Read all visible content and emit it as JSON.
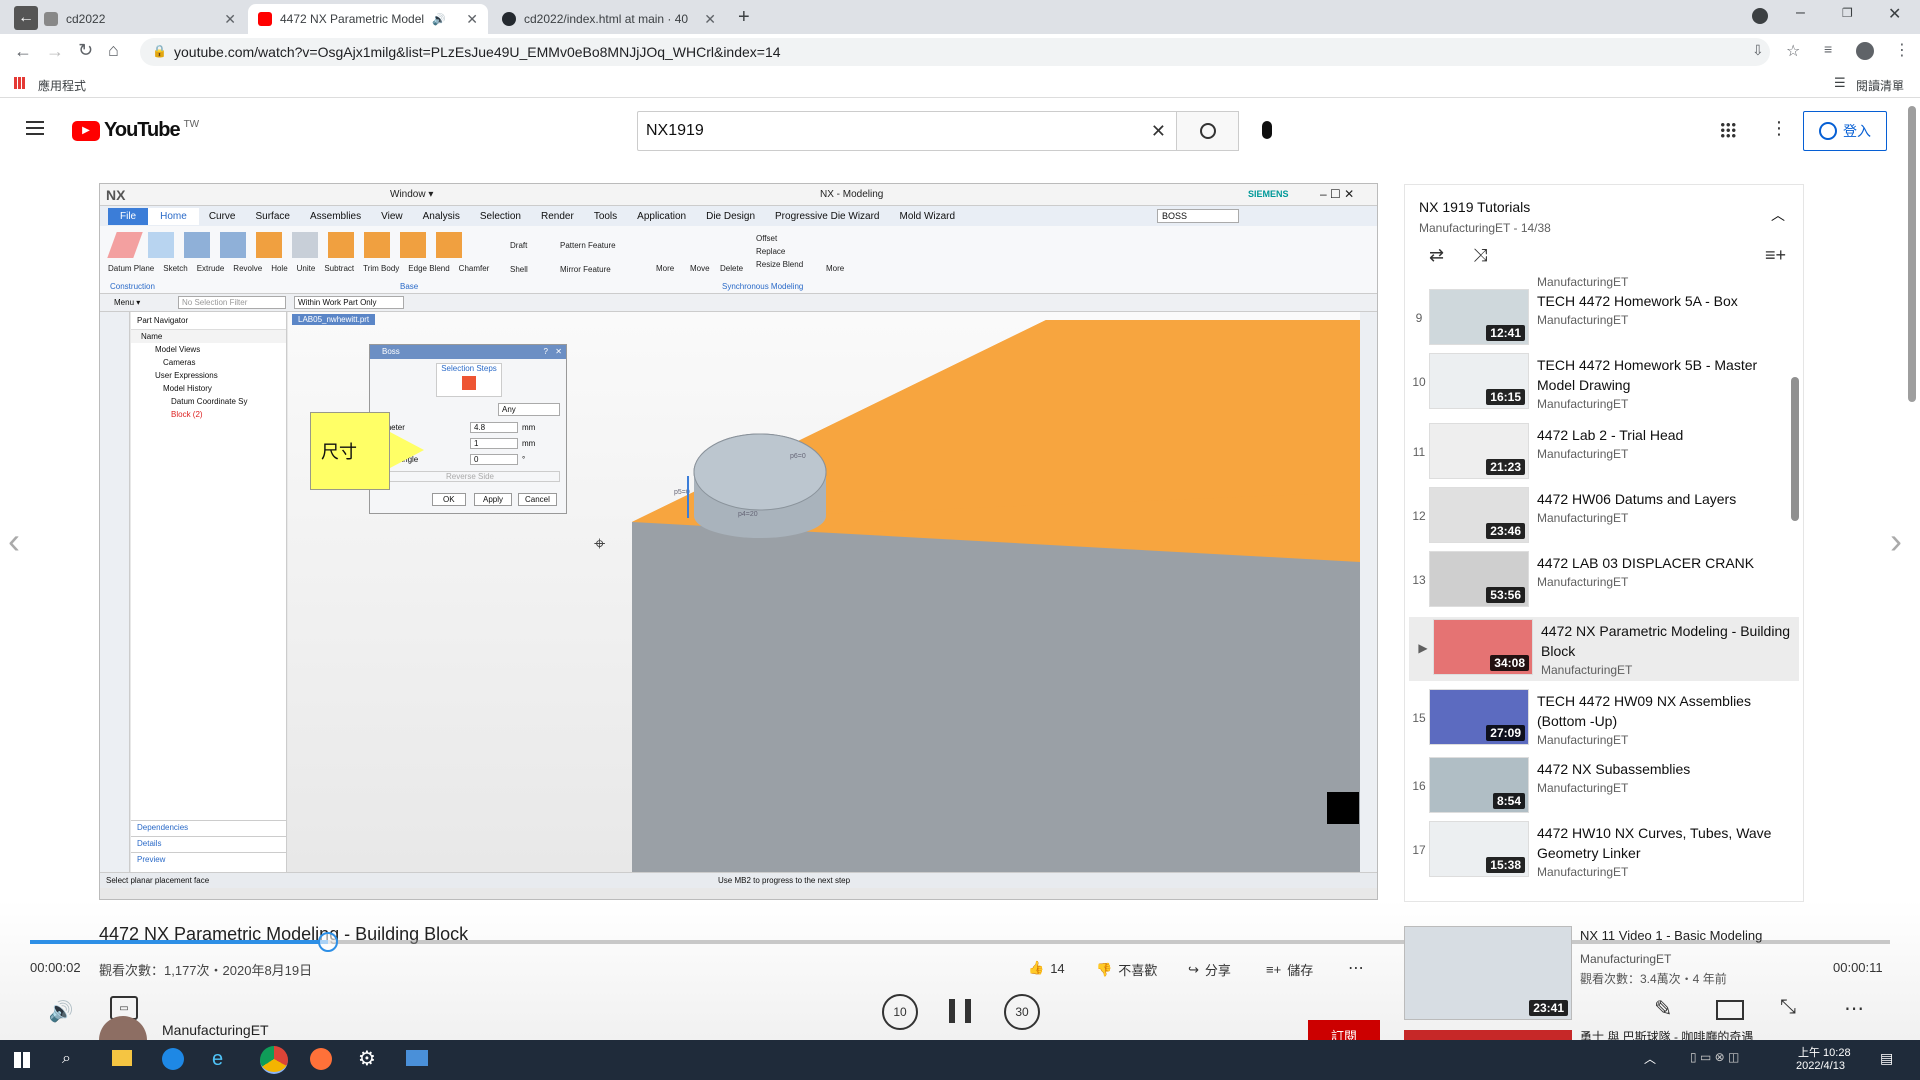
{
  "browser": {
    "tabs": [
      {
        "title": "cd2022",
        "fav": "#888"
      },
      {
        "title": "4472 NX Parametric Model",
        "fav": "#ff0000"
      },
      {
        "title": "cd2022/index.html at main · 40",
        "fav": "#24292f"
      }
    ],
    "url": "youtube.com/watch?v=OsgAjx1milg&list=PLzEsJue49U_EMMv0eBo8MNJjJOq_WHCrl&index=14",
    "bookmarks_apps": "應用程式",
    "reading_list": "閱讀清單"
  },
  "youtube": {
    "logo_text": "YouTube",
    "region": "TW",
    "search_value": "NX1919",
    "signin_label": "登入"
  },
  "nx": {
    "title": "NX - Modeling",
    "brand": "SIEMENS",
    "window_menu": "Window ▾",
    "file_tab": "File",
    "ribbon_tabs": [
      "Home",
      "Curve",
      "Surface",
      "Assemblies",
      "View",
      "Analysis",
      "Selection",
      "Render",
      "Tools",
      "Application",
      "Die Design",
      "Progressive Die Wizard",
      "Mold Wizard"
    ],
    "search_value": "BOSS",
    "tools": [
      "Datum Plane",
      "Sketch",
      "Extrude",
      "Revolve",
      "Hole",
      "Unite",
      "Subtract",
      "Trim Body",
      "Edge Blend",
      "Chamfer",
      "More",
      "Move",
      "Delete",
      "More"
    ],
    "tools_small": [
      "Draft",
      "Shell",
      "Pattern Feature",
      "Mirror Feature",
      "Offset",
      "Replace",
      "Resize Blend"
    ],
    "groups": [
      "Construction",
      "Base",
      "Synchronous Modeling"
    ],
    "menu_label": "Menu ▾",
    "filter_placeholder": "No Selection Filter",
    "scope": "Within Work Part Only",
    "navigator_title": "Part Navigator",
    "nav_col": "Name",
    "nav_items": [
      "Model Views",
      "Cameras",
      "User Expressions",
      "Model History",
      "Datum Coordinate Sy",
      "Block (2)"
    ],
    "nav_panels": [
      "Dependencies",
      "Details",
      "Preview"
    ],
    "file_tab_name": "LAB05_nwhewitt.prt",
    "dialog": {
      "title": "Boss",
      "steps_label": "Selection Steps",
      "filter": "Any",
      "rows": [
        {
          "label": "ameter",
          "value": "4.8",
          "unit": "mm"
        },
        {
          "label": "ight",
          "value": "1",
          "unit": "mm"
        },
        {
          "label": "aper Angle",
          "value": "0",
          "unit": "°"
        }
      ],
      "reverse": "Reverse Side",
      "ok": "OK",
      "apply": "Apply",
      "cancel": "Cancel"
    },
    "callout": "尺寸",
    "status_left": "Select planar placement face",
    "status_center": "Use MB2 to progress to the next step",
    "label_p6": "p6=0",
    "label_p4": "p4=20",
    "label_p5": "p5=0"
  },
  "playlist": {
    "title": "NX 1919 Tutorials",
    "meta": "ManufacturingET - 14/38",
    "top_channel": "ManufacturingET",
    "items": [
      {
        "num": "9",
        "title": "TECH 4472 Homework 5A - Box",
        "channel": "ManufacturingET",
        "duration": "12:41",
        "color": "#cfd8dc"
      },
      {
        "num": "10",
        "title": "TECH 4472 Homework 5B - Master Model Drawing",
        "channel": "ManufacturingET",
        "duration": "16:15",
        "color": "#eceff1"
      },
      {
        "num": "11",
        "title": "4472 Lab 2 - Trial Head",
        "channel": "ManufacturingET",
        "duration": "21:23",
        "color": "#eeeeee"
      },
      {
        "num": "12",
        "title": "4472 HW06 Datums and Layers",
        "channel": "ManufacturingET",
        "duration": "23:46",
        "color": "#e0e0e0"
      },
      {
        "num": "13",
        "title": "4472 LAB 03 DISPLACER CRANK",
        "channel": "ManufacturingET",
        "duration": "53:56",
        "color": "#cfcfcf"
      },
      {
        "num": "▶",
        "title": "4472 NX Parametric Modeling - Building Block",
        "channel": "ManufacturingET",
        "duration": "34:08",
        "color": "#e57373"
      },
      {
        "num": "15",
        "title": "TECH 4472 HW09 NX Assemblies (Bottom -Up)",
        "channel": "ManufacturingET",
        "duration": "27:09",
        "color": "#5c6bc0"
      },
      {
        "num": "16",
        "title": "4472 NX Subassemblies",
        "channel": "ManufacturingET",
        "duration": "8:54",
        "color": "#b0bec5"
      },
      {
        "num": "17",
        "title": "4472 HW10 NX Curves, Tubes, Wave Geometry Linker",
        "channel": "ManufacturingET",
        "duration": "15:38",
        "color": "#eceff1"
      }
    ]
  },
  "video_info": {
    "title": "4472 NX Parametric Modeling - Building Block",
    "views": "觀看次數：1,177次・2020年8月19日",
    "likes": "14",
    "dislike": "不喜歡",
    "share": "分享",
    "save": "儲存",
    "channel": "ManufacturingET",
    "subscribe": "訂閱",
    "time_current": "00:00:02",
    "time_total": "00:00:11",
    "progress": 0.16
  },
  "recommended": {
    "title": "NX 11 Video 1 - Basic Modeling",
    "channel": "ManufacturingET",
    "meta": "觀看次數：3.4萬次・4 年前",
    "duration": "23:41",
    "next_title": "勇士 與 巴斯球隊 - 咖啡廳的奇遇"
  },
  "player_controls": {
    "rewind": "10",
    "forward": "30"
  },
  "taskbar": {
    "time": "上午 10:28",
    "date": "2022/4/13"
  }
}
